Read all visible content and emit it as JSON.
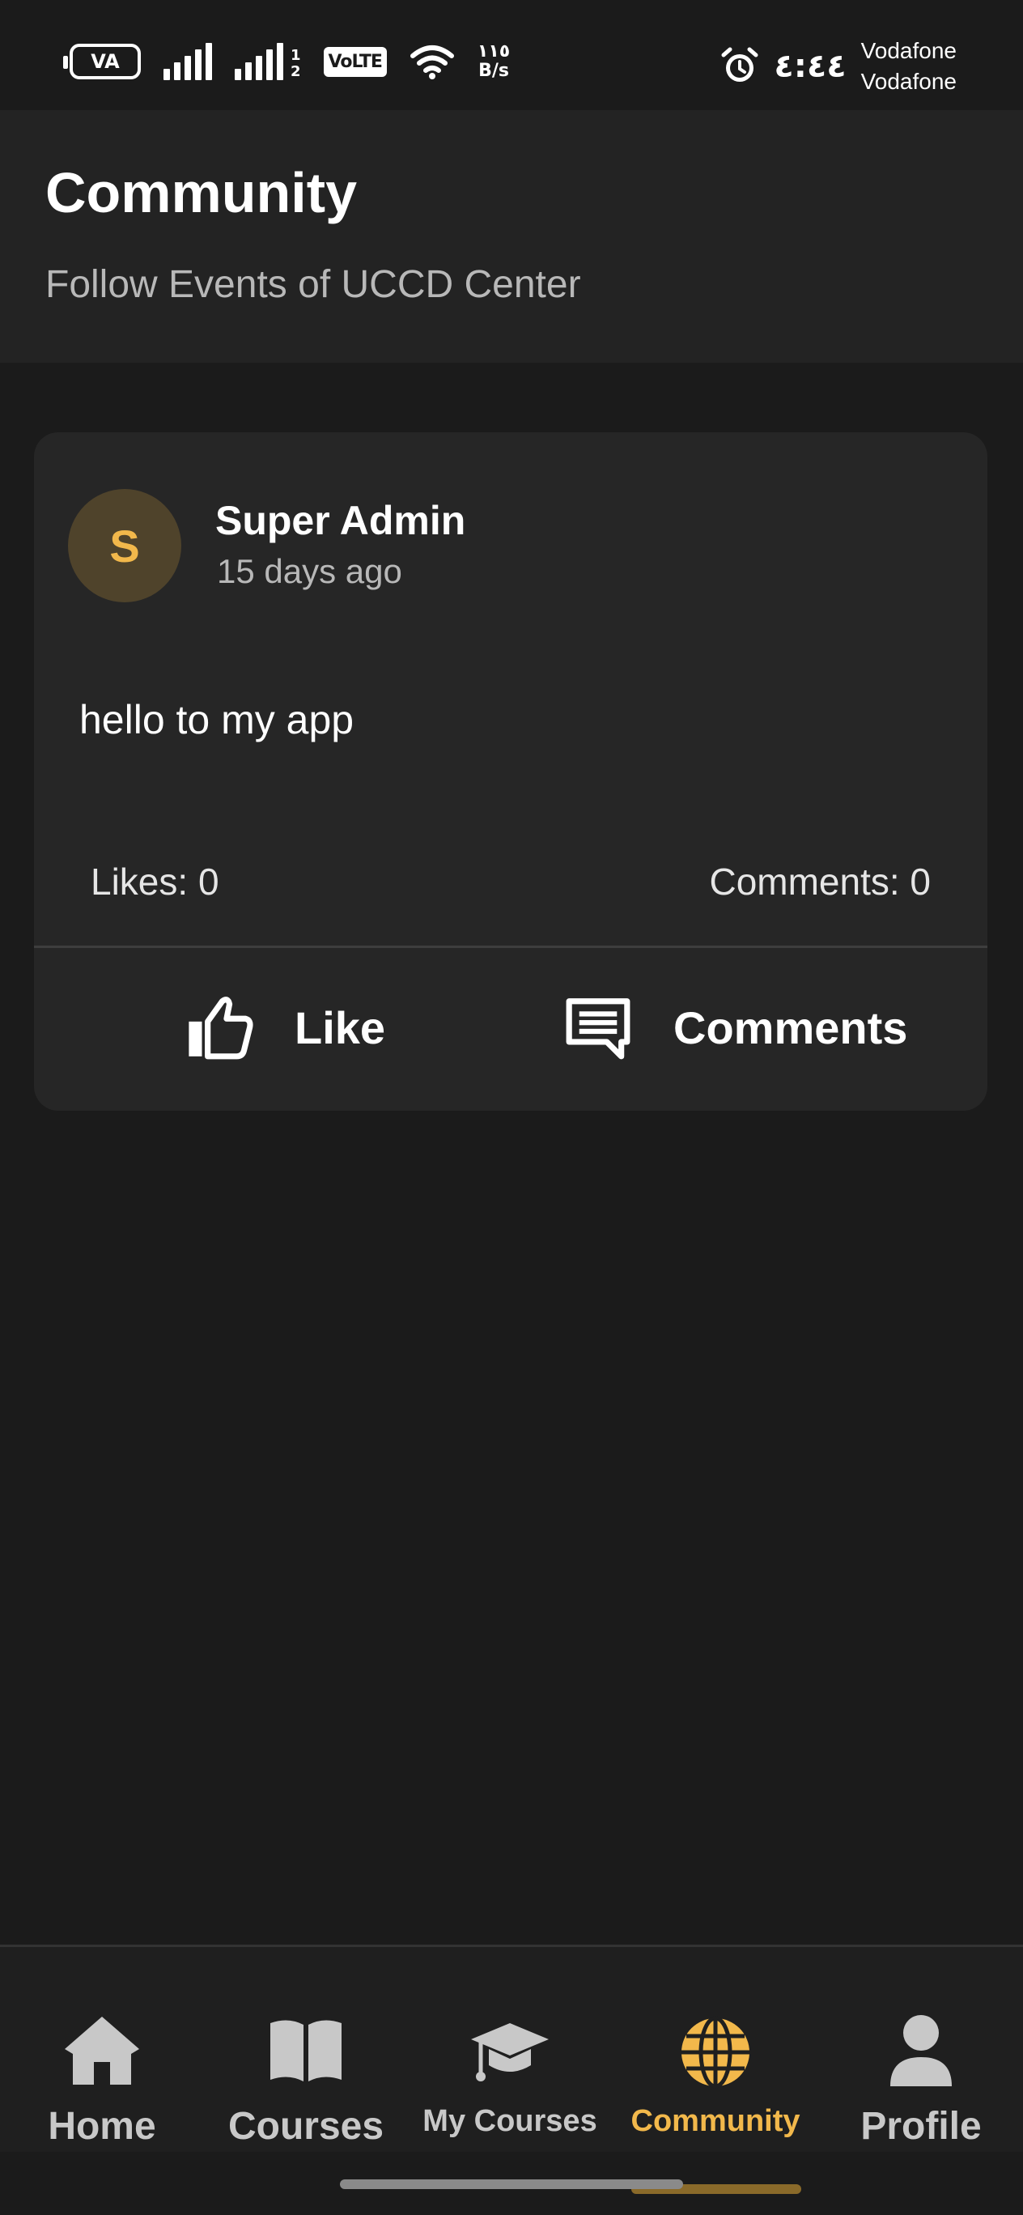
{
  "status_bar": {
    "battery": "VA",
    "sim_label": "1\n2",
    "volte": "VoLTE",
    "speed_value": "١١٥",
    "speed_unit": "B/s",
    "time": "٤:٤٤",
    "carrier_1": "Vodafone",
    "carrier_2": "Vodafone"
  },
  "header": {
    "title": "Community",
    "subtitle": "Follow Events of UCCD Center"
  },
  "post": {
    "avatar_initial": "S",
    "author": "Super Admin",
    "time_ago": "15 days ago",
    "body": "hello to my app",
    "likes_text": "Likes: 0",
    "comments_text": "Comments: 0",
    "like_label": "Like",
    "comments_label": "Comments"
  },
  "bottom_nav": {
    "items": [
      {
        "label": "Home",
        "icon": "home-icon"
      },
      {
        "label": "Courses",
        "icon": "book-icon"
      },
      {
        "label": "My Courses",
        "icon": "graduation-cap-icon"
      },
      {
        "label": "Community",
        "icon": "globe-icon",
        "active": true
      },
      {
        "label": "Profile",
        "icon": "person-icon"
      }
    ]
  },
  "colors": {
    "background": "#1b1b1b",
    "card": "#262626",
    "accent": "#f2b84b",
    "muted_text": "#b8b8b8"
  }
}
